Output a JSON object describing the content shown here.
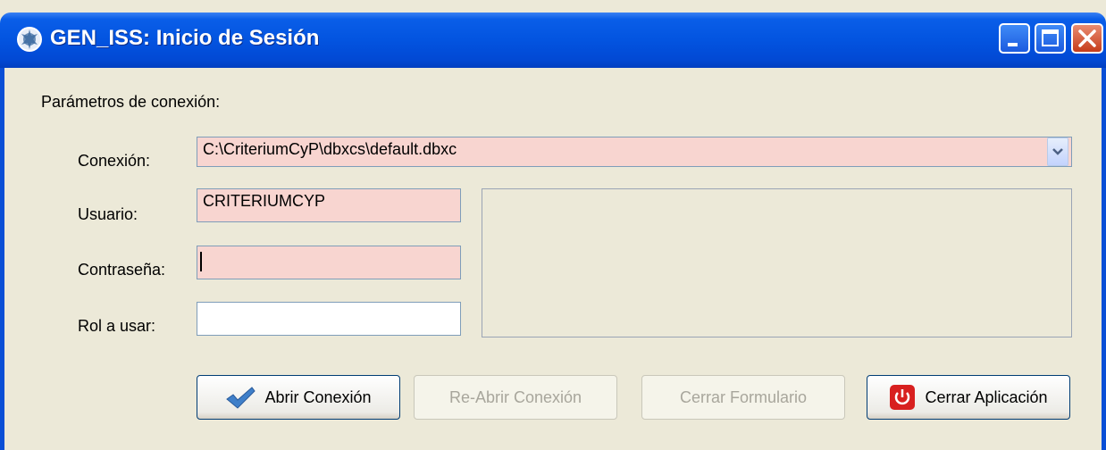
{
  "window": {
    "title": "GEN_ISS: Inicio de Sesión"
  },
  "form": {
    "section_label": "Parámetros de conexión:",
    "connection_label": "Conexión:",
    "connection_value": "C:\\CriteriumCyP\\dbxcs\\default.dbxc",
    "user_label": "Usuario:",
    "user_value": "CRITERIUMCYP",
    "password_label": "Contraseña:",
    "password_value": "",
    "role_label": "Rol a usar:",
    "role_value": ""
  },
  "buttons": {
    "open": "Abrir Conexión",
    "reopen": "Re-Abrir Conexión",
    "close_form": "Cerrar Formulario",
    "close_app": "Cerrar Aplicación"
  },
  "colors": {
    "required_field": "#F8D5D0",
    "titlebar": "#0354E0",
    "window_bg": "#ECE9D8"
  },
  "icons": {
    "app": "app-logo-icon",
    "open": "checkmark-icon",
    "close_app": "power-icon"
  }
}
